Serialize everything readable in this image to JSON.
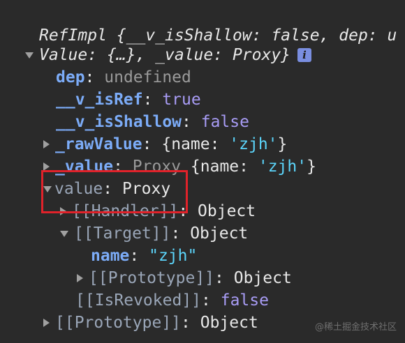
{
  "object": {
    "header_line1": "RefImpl {__v_isShallow: false, dep: u",
    "header_line2": "Value: {…}, _value: Proxy}",
    "info_icon": "info-icon",
    "info_label": "i"
  },
  "props": {
    "dep": {
      "key": "dep",
      "value": "undefined"
    },
    "v_isRef": {
      "key": "__v_isRef",
      "value": "true"
    },
    "v_isShallow": {
      "key": "__v_isShallow",
      "value": "false"
    },
    "rawValue": {
      "key": "_rawValue",
      "preview_open": "{",
      "preview_key": "name",
      "preview_value": "'zjh'",
      "preview_close": "}"
    },
    "_value": {
      "key": "_value",
      "type": "Proxy",
      "preview_open": "{",
      "preview_key": "name",
      "preview_value": "'zjh'",
      "preview_close": "}"
    },
    "value": {
      "key": "value",
      "type": "Proxy"
    },
    "handler": {
      "key": "[[Handler]]",
      "value": "Object"
    },
    "target": {
      "key": "[[Target]]",
      "value": "Object"
    },
    "target_name": {
      "key": "name",
      "value": "\"zjh\""
    },
    "target_proto": {
      "key": "[[Prototype]]",
      "value": "Object"
    },
    "isRevoked": {
      "key": "[[IsRevoked]]",
      "value": "false"
    },
    "proto": {
      "key": "[[Prototype]]",
      "value": "Object"
    }
  },
  "watermark": "@稀土掘金技术社区",
  "colors": {
    "background": "#2a2a2a",
    "key": "#7cacf8",
    "internal_key": "#9aa6b8",
    "keyword": "#a89cf5",
    "string": "#5cd5fb",
    "highlight": "#e0222a"
  }
}
